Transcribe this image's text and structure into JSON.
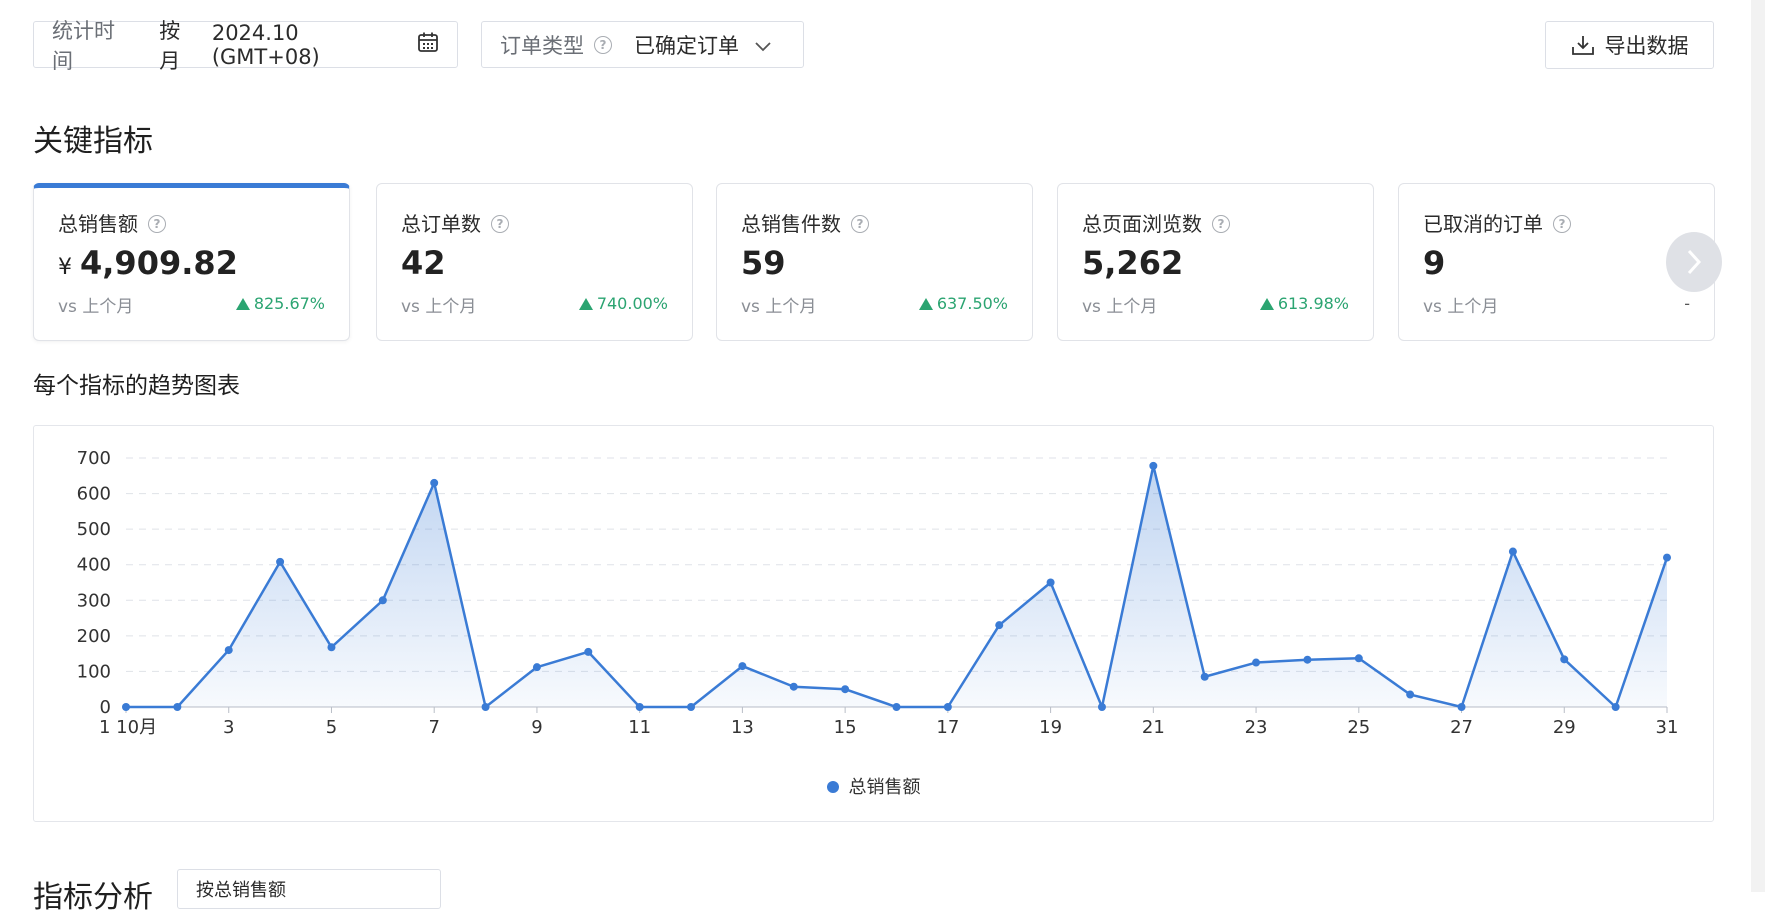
{
  "filters": {
    "period_label": "统计时间",
    "period_mode": "按月",
    "period_value": "2024.10 (GMT+08)",
    "order_type_label": "订单类型",
    "order_type_value": "已确定订单"
  },
  "export_label": "导出数据",
  "key_metrics_title": "关键指标",
  "metrics": [
    {
      "title": "总销售额",
      "currency": "¥",
      "value": "4,909.82",
      "vs": "vs 上个月",
      "delta": "825.67%"
    },
    {
      "title": "总订单数",
      "value": "42",
      "vs": "vs 上个月",
      "delta": "740.00%"
    },
    {
      "title": "总销售件数",
      "value": "59",
      "vs": "vs 上个月",
      "delta": "637.50%"
    },
    {
      "title": "总页面浏览数",
      "value": "5,262",
      "vs": "vs 上个月",
      "delta": "613.98%"
    },
    {
      "title": "已取消的订单",
      "value": "9",
      "vs": "vs 上个月",
      "delta": "-"
    }
  ],
  "trend_title": "每个指标的趋势图表",
  "analysis_title": "指标分析",
  "analysis_select_value": "按总销售额",
  "colors": {
    "accent": "#3a7bd5",
    "positive": "#2ba471"
  },
  "chart_data": {
    "type": "area",
    "x": [
      1,
      2,
      3,
      4,
      5,
      6,
      7,
      8,
      9,
      10,
      11,
      12,
      13,
      14,
      15,
      16,
      17,
      18,
      19,
      20,
      21,
      22,
      23,
      24,
      25,
      26,
      27,
      28,
      29,
      30,
      31
    ],
    "x_tick_labels": [
      "1 10月",
      "3",
      "5",
      "7",
      "9",
      "11",
      "13",
      "15",
      "17",
      "19",
      "21",
      "23",
      "25",
      "27",
      "29",
      "31"
    ],
    "y_ticks": [
      "0",
      "100",
      "200",
      "300",
      "400",
      "500",
      "600",
      "700"
    ],
    "ylim": [
      0,
      700
    ],
    "grid": "horizontal dashed",
    "legend_position": "bottom-center",
    "series": [
      {
        "name": "总销售额",
        "values": [
          0,
          0,
          160,
          408,
          168,
          300,
          630,
          0,
          112,
          155,
          0,
          0,
          115,
          57,
          50,
          0,
          0,
          230,
          350,
          0,
          678,
          85,
          125,
          133,
          137,
          35,
          0,
          437,
          134,
          0,
          420
        ]
      }
    ]
  }
}
